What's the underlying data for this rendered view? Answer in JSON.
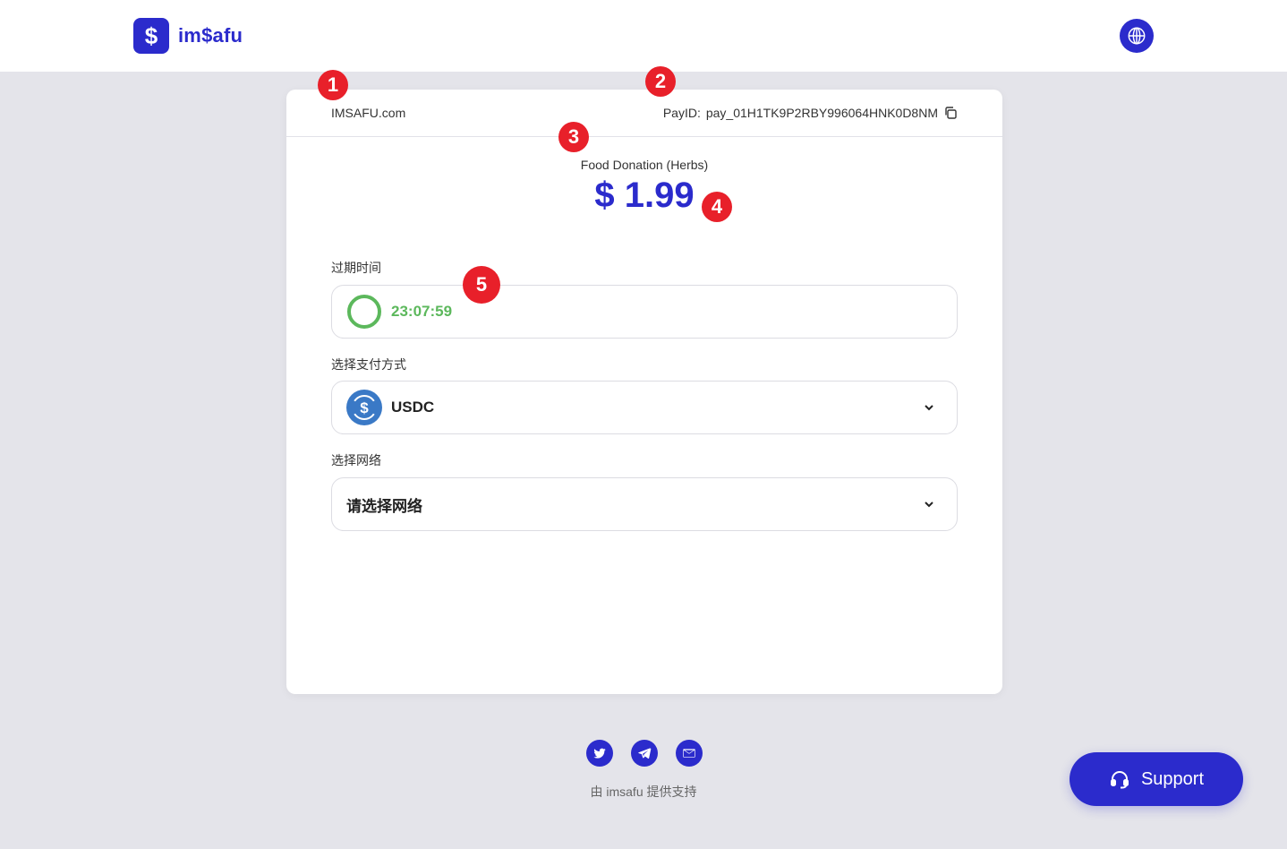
{
  "header": {
    "logo_symbol": "$",
    "logo_text": "im$afu",
    "language_icon": "globe-icon",
    "brand_color": "#2b2bcc"
  },
  "card": {
    "merchant": "IMSAFU.com",
    "payid_label": "PayID:",
    "payid_value": "pay_01H1TK9P2RBY996064HNK0D8NM",
    "product_name": "Food Donation (Herbs)",
    "amount": "$ 1.99"
  },
  "expiry": {
    "label": "过期时间",
    "countdown": "23:07:59",
    "color": "#5cb85c"
  },
  "payment_method": {
    "label": "选择支付方式",
    "selected": "USDC",
    "icon": "usdc-icon"
  },
  "network": {
    "label": "选择网络",
    "placeholder": "请选择网络"
  },
  "annotations": [
    "1",
    "2",
    "3",
    "4",
    "5"
  ],
  "footer": {
    "social": [
      "twitter-icon",
      "telegram-icon",
      "mail-icon"
    ],
    "powered_by": "由 imsafu 提供支持"
  },
  "support": {
    "label": "Support",
    "icon": "headset-icon"
  }
}
